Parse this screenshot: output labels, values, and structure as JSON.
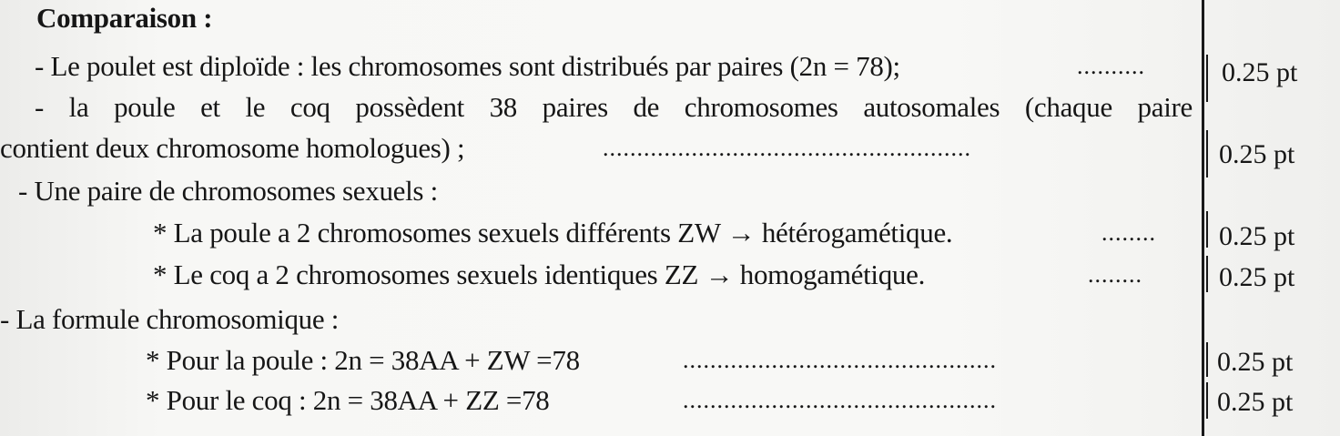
{
  "title": "Comparaison :",
  "lines": [
    {
      "text": "- Le poulet est diploïde : les chromosomes sont distribués par paires (2n = 78); ",
      "dots": "..........",
      "points": "0.25 pt"
    },
    {
      "text": "- la poule et le coq possèdent 38 paires de chromosomes autosomales (chaque paire"
    },
    {
      "text": "contient deux chromosome homologues) ; ",
      "dots": "......................................................",
      "points": "0.25 pt"
    },
    {
      "text": "- Une paire de chromosomes sexuels :"
    },
    {
      "text": "* La poule a 2 chromosomes sexuels différents ZW → hétérogamétique. ",
      "dots": "........",
      "points": "0.25 pt"
    },
    {
      "text": "* Le coq a 2 chromosomes sexuels identiques ZZ → homogamétique.",
      "dots": "........",
      "points": "0.25 pt"
    },
    {
      "text": "- La formule chromosomique :"
    },
    {
      "text": "* Pour la poule :  2n = 38AA + ZW =78",
      "dots": "..............................................",
      "points": "0.25 pt"
    },
    {
      "text": "* Pour le coq :  2n = 38AA + ZZ  =78",
      "dots": "..............................................",
      "points": "0.25 pt"
    }
  ]
}
